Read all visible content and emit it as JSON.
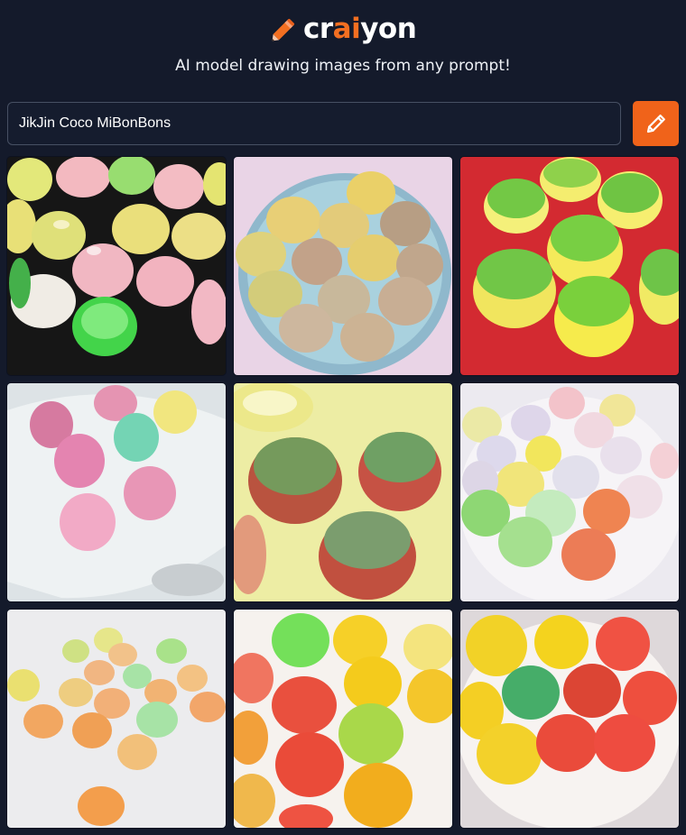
{
  "brand": {
    "name_prefix": "cr",
    "name_accent": "ai",
    "name_suffix": "yon",
    "accent_color": "#f36f21",
    "icon": "pencil-icon"
  },
  "tagline": "AI model drawing images from any prompt!",
  "search": {
    "value": "JikJin Coco MiBonBons",
    "placeholder": ""
  },
  "draw_button": {
    "icon": "pencil-icon"
  },
  "results": {
    "images": [
      {
        "description": "pastel sugared gummy candies on black"
      },
      {
        "description": "sugared gummies on a light blue plate"
      },
      {
        "description": "green and yellow gummies on red"
      },
      {
        "description": "sugared pink gum balls on white tray"
      },
      {
        "description": "red and green gummy drops on yellow"
      },
      {
        "description": "sugared pastel gum balls on white plate"
      },
      {
        "description": "small blurred gummies on white"
      },
      {
        "description": "colorful sugared gummies"
      },
      {
        "description": "red and yellow gummies in white bowl"
      }
    ]
  },
  "colors": {
    "background": "#141a2b",
    "button": "#f0631a",
    "input_border": "#475063"
  }
}
